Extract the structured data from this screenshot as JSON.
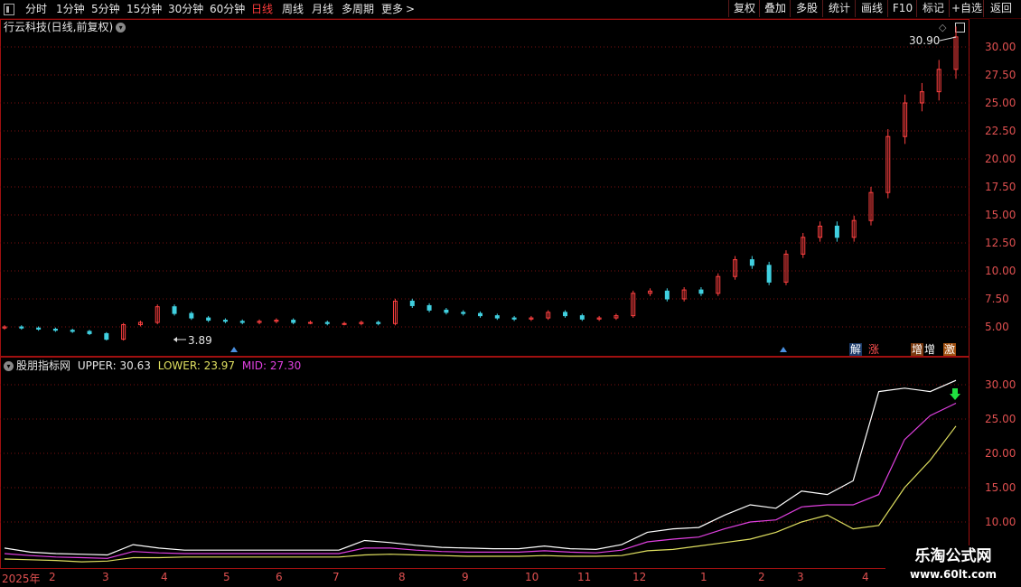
{
  "toolbar": {
    "periods": [
      "分时",
      "1分钟",
      "5分钟",
      "15分钟",
      "30分钟",
      "60分钟",
      "日线",
      "周线",
      "月线",
      "多周期",
      "更多"
    ],
    "active_period": "日线",
    "more_arrow": ">",
    "buttons": [
      "复权",
      "叠加",
      "多股",
      "统计",
      "画线",
      "F10",
      "标记",
      "+自选",
      "返回"
    ]
  },
  "main_chart": {
    "title": "行云科技(日线,前复权)",
    "high_label": "30.90",
    "low_label": "3.89",
    "y_ticks": [
      "30.00",
      "27.50",
      "25.00",
      "22.50",
      "20.00",
      "17.50",
      "15.00",
      "12.50",
      "10.00",
      "7.50",
      "5.00"
    ],
    "tags": [
      "解",
      "涨",
      "增",
      "增",
      "激"
    ]
  },
  "indicator": {
    "name": "股朋指标网",
    "upper_label": "UPPER: 30.63",
    "lower_label": "LOWER: 23.97",
    "mid_label": "MID: 27.30",
    "y_ticks": [
      "30.00",
      "25.00",
      "20.00",
      "15.00",
      "10.00"
    ]
  },
  "x_axis": [
    "2025年",
    "2",
    "3",
    "4",
    "5",
    "6",
    "7",
    "8",
    "9",
    "10",
    "11",
    "12",
    "1",
    "2",
    "3",
    "4"
  ],
  "watermark": {
    "line1": "乐淘公式网",
    "line2": "www.60lt.com"
  },
  "colors": {
    "up": "#ff4040",
    "down": "#40d0e0",
    "upper": "#ffffff",
    "lower": "#e0e060",
    "mid": "#e040e0",
    "grid": "#7a1010"
  },
  "chart_data": [
    {
      "type": "candlestick",
      "title": "行云科技(日线,前复权)",
      "ylim": [
        2.5,
        31.5
      ],
      "x_ticks": [
        "2025年",
        "2",
        "3",
        "4",
        "5",
        "6",
        "7",
        "8",
        "9",
        "10",
        "11",
        "12",
        "1",
        "2",
        "3",
        "4"
      ],
      "close_approx": [
        5.0,
        4.9,
        4.8,
        4.7,
        4.6,
        4.4,
        3.9,
        5.2,
        5.4,
        6.8,
        6.2,
        5.8,
        5.6,
        5.5,
        5.4,
        5.5,
        5.6,
        5.4,
        5.4,
        5.3,
        5.3,
        5.4,
        5.3,
        7.3,
        6.9,
        6.5,
        6.3,
        6.2,
        6.0,
        5.8,
        5.7,
        5.8,
        6.3,
        6.0,
        5.7,
        5.8,
        6.0,
        8.0,
        8.2,
        7.5,
        8.3,
        8.0,
        9.5,
        11.0,
        10.5,
        9.0,
        11.5,
        13.0,
        14.0,
        13.0,
        14.5,
        17.0,
        22.0,
        25.0,
        26.0,
        28.0,
        30.9
      ],
      "high": 30.9,
      "low": 3.89
    },
    {
      "type": "line",
      "title": "股朋指标网",
      "ylim": [
        7,
        33
      ],
      "series": [
        {
          "name": "UPPER",
          "last": 30.63,
          "values": [
            6.2,
            5.6,
            5.4,
            5.3,
            5.2,
            6.7,
            6.2,
            5.9,
            5.9,
            5.9,
            5.9,
            5.9,
            5.9,
            5.9,
            7.3,
            7.0,
            6.6,
            6.3,
            6.2,
            6.1,
            6.1,
            6.5,
            6.1,
            6.0,
            6.7,
            8.5,
            9.0,
            9.2,
            11.0,
            12.5,
            12.0,
            14.5,
            14.0,
            16.0,
            29.0,
            29.5,
            29.0,
            30.63
          ]
        },
        {
          "name": "LOWER",
          "last": 23.97,
          "values": [
            4.6,
            4.5,
            4.4,
            4.2,
            4.3,
            4.8,
            4.8,
            4.9,
            4.9,
            4.9,
            4.9,
            4.9,
            4.9,
            4.9,
            5.2,
            5.3,
            5.2,
            5.1,
            5.0,
            5.0,
            5.0,
            5.1,
            5.0,
            5.0,
            5.1,
            5.8,
            6.0,
            6.5,
            7.0,
            7.5,
            8.5,
            10.0,
            11.0,
            9.0,
            9.5,
            15.0,
            19.0,
            23.97
          ]
        },
        {
          "name": "MID",
          "last": 27.3,
          "values": [
            5.4,
            5.1,
            4.9,
            4.8,
            4.7,
            5.7,
            5.5,
            5.4,
            5.4,
            5.4,
            5.4,
            5.4,
            5.4,
            5.4,
            6.2,
            6.2,
            5.9,
            5.7,
            5.6,
            5.6,
            5.6,
            5.8,
            5.6,
            5.5,
            5.9,
            7.1,
            7.5,
            7.8,
            9.0,
            10.0,
            10.3,
            12.2,
            12.5,
            12.5,
            14.0,
            22.0,
            25.5,
            27.3
          ]
        }
      ]
    }
  ]
}
